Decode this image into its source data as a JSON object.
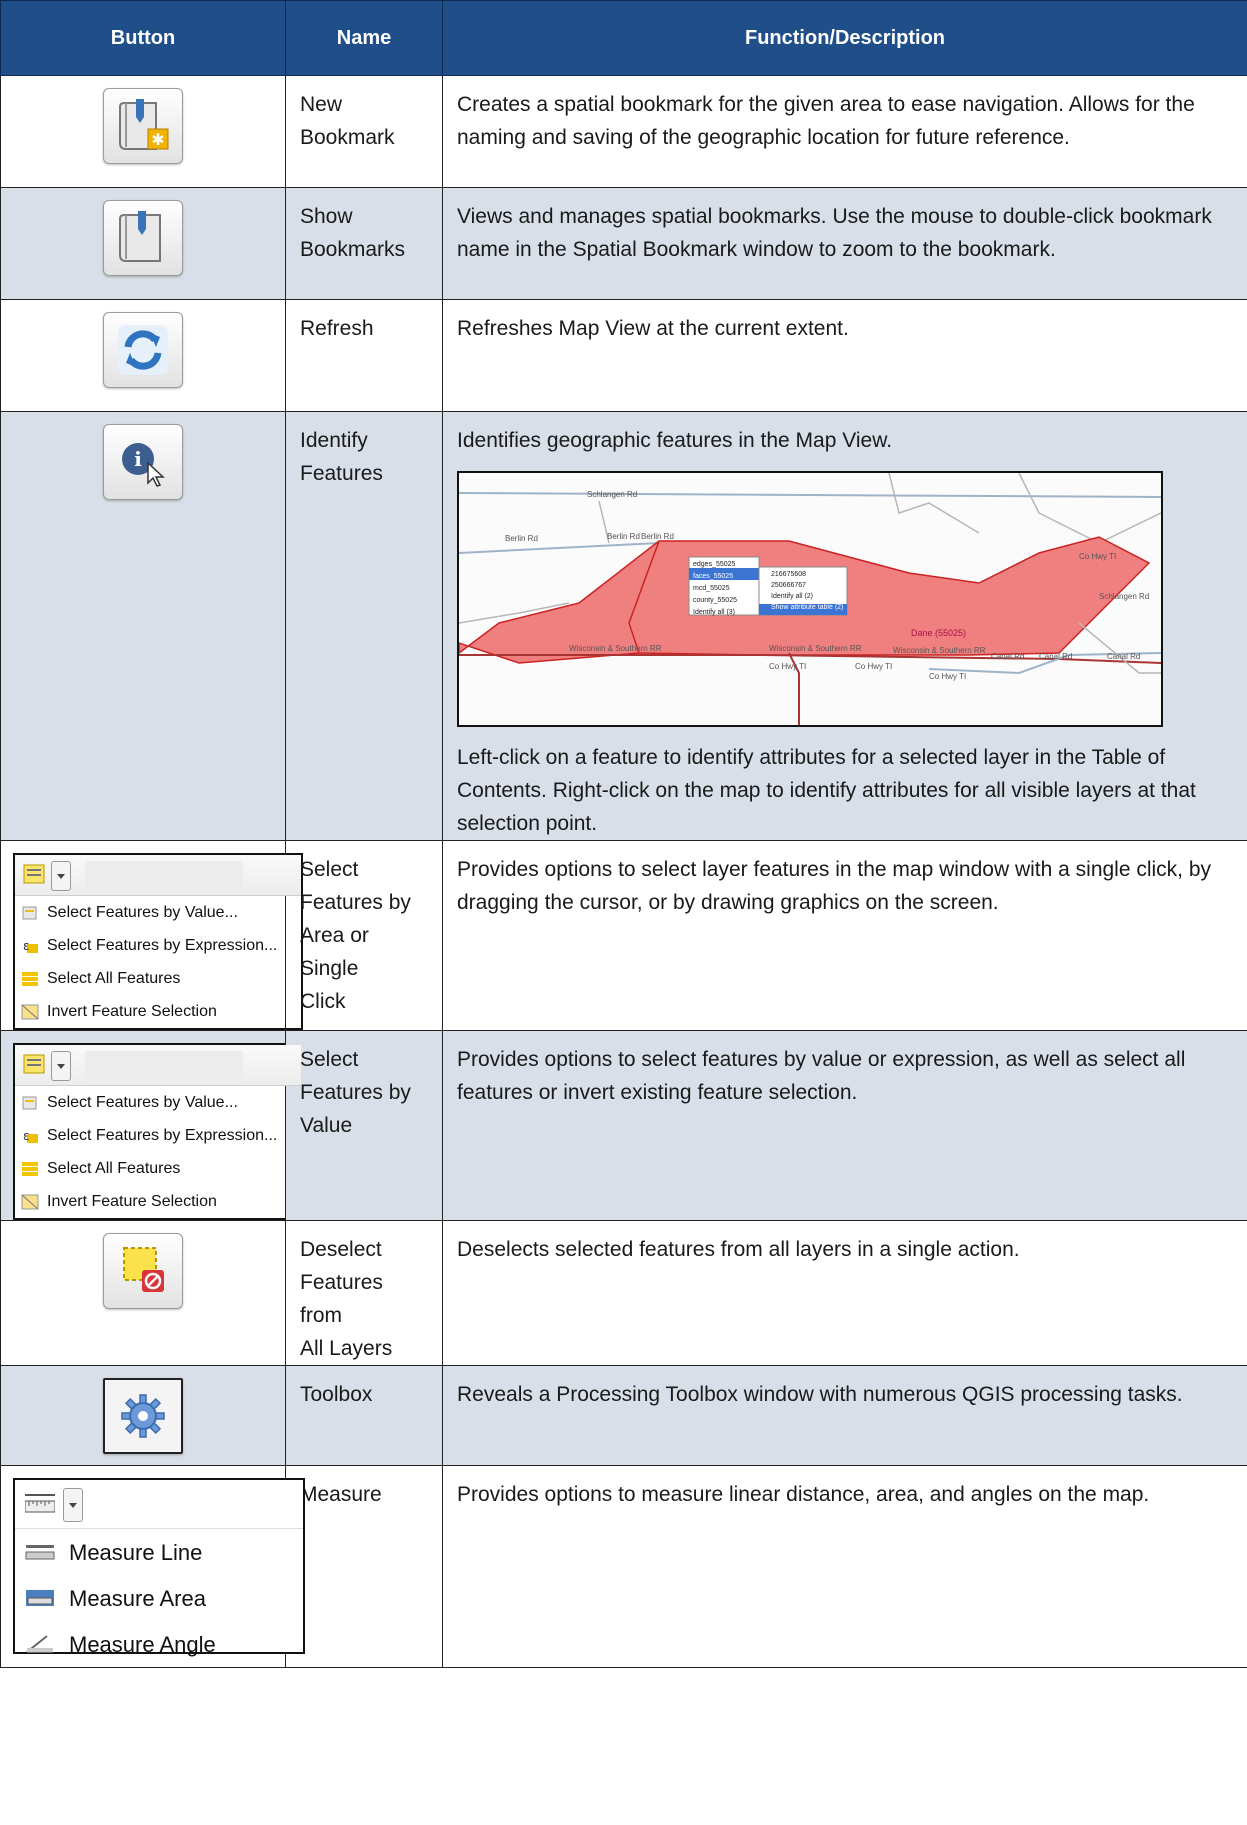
{
  "header": {
    "col_button": "Button",
    "col_name": "Name",
    "col_desc": "Function/Description"
  },
  "rows": [
    {
      "name": "New\nBookmark",
      "desc": "Creates a spatial bookmark for the given area to ease navigation. Allows for the naming and saving of the geographic location for future reference.",
      "icon": "new-bookmark-icon"
    },
    {
      "name": "Show\nBookmarks",
      "desc": "Views and manages spatial bookmarks. Use the mouse to double-click bookmark name in the Spatial Bookmark window to zoom to the bookmark.",
      "icon": "show-bookmarks-icon"
    },
    {
      "name": "Refresh",
      "desc": "Refreshes Map View at the current extent.",
      "icon": "refresh-icon"
    },
    {
      "name": "Identify\nFeatures",
      "desc": "Identifies geographic features in the Map View.",
      "desc2": "Left-click on a feature to identify attributes for a selected layer in the Table of Contents. Right-click on the map to identify attributes for all visible layers at that selection point.",
      "icon": "identify-icon"
    },
    {
      "name": "Select\nFeatures by\nArea or Single\nClick",
      "desc": "Provides options to select layer features in the map window with a single click, by dragging the cursor, or by drawing graphics on the screen."
    },
    {
      "name": "Select\nFeatures by\nValue",
      "desc": "Provides options to select features by value or expression, as well as select all features or invert existing feature selection."
    },
    {
      "name": "Deselect\nFeatures from\nAll Layers",
      "desc": "Deselects selected features from all layers in a single action.",
      "icon": "deselect-icon"
    },
    {
      "name": "Toolbox",
      "desc": "Reveals a Processing Toolbox window with numerous QGIS processing tasks.",
      "icon": "toolbox-gear-icon"
    },
    {
      "name": "Measure",
      "desc": "Provides options to measure linear distance, area, and angles on the map."
    }
  ],
  "select_menu": {
    "items": [
      "Select Features by Value...",
      "Select Features by Expression...",
      "Select All Features",
      "Invert Feature Selection"
    ]
  },
  "measure_menu": {
    "items": [
      "Measure Line",
      "Measure Area",
      "Measure Angle"
    ]
  },
  "map": {
    "roads": [
      "Schlangen Rd",
      "Berlin Rd",
      "Berlin Rd",
      "Berlin Rd",
      "Wisconsin & Southern RR",
      "Wisconsin & Southern RR",
      "Wisconsin & Southern RR",
      "Co Hwy TI",
      "Co Hwy TI",
      "Canal Rd",
      "Canal Rd",
      "Canal Rd",
      "Co Hwy TI",
      "Co Hwy TI",
      "Schlangen Rd"
    ],
    "popup_layers": [
      "edges_55025",
      "faces_55025",
      "mcd_55025",
      "county_55025",
      "Identify all (3)"
    ],
    "popup_sub": [
      "216675608",
      "250666767",
      "Identify all (2)",
      "Show attribute table (2)"
    ],
    "area_label": "Dane (55025)"
  },
  "colors": {
    "header_bg": "#1f4e89",
    "alt_row": "#d8dfe8",
    "feature_fill": "#f08080"
  }
}
